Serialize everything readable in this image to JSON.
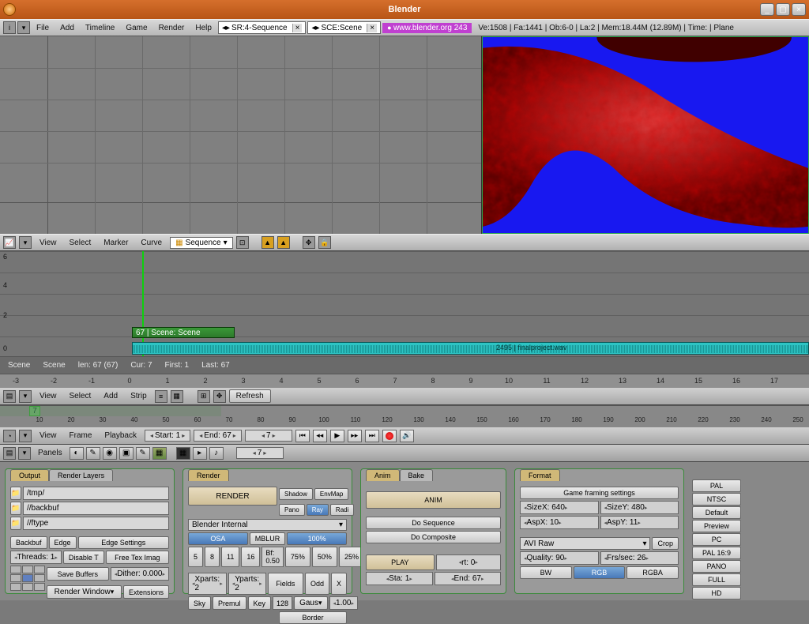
{
  "window": {
    "title": "Blender"
  },
  "topmenu": {
    "file": "File",
    "add": "Add",
    "timeline": "Timeline",
    "game": "Game",
    "render": "Render",
    "help": "Help",
    "screen": "SR:4-Sequence",
    "scene": "SCE:Scene",
    "link": "www.blender.org 243",
    "stats": "Ve:1508 | Fa:1441 | Ob:6-0 | La:2 | Mem:18.44M (12.89M) | Time: | Plane"
  },
  "ipo": {
    "view": "View",
    "select": "Select",
    "marker": "Marker",
    "curve": "Curve",
    "type": "Sequence"
  },
  "seq": {
    "scene_strip": "67 | Scene: Scene",
    "audio_strip": "2495 | finalproject.wav",
    "info_scene1": "Scene",
    "info_scene2": "Scene",
    "info_len": "len: 67 (67)",
    "info_cur": "Cur: 7",
    "info_first": "First: 1",
    "info_last": "Last: 67",
    "ticks": [
      "-3",
      "-2",
      "-1",
      "0",
      "1",
      "2",
      "3",
      "4",
      "5",
      "6",
      "7",
      "8",
      "9",
      "10",
      "11",
      "12",
      "13",
      "14",
      "15",
      "16",
      "17"
    ],
    "axis": [
      "0",
      "2",
      "4",
      "6"
    ],
    "header": {
      "view": "View",
      "select": "Select",
      "add": "Add",
      "strip": "Strip",
      "refresh": "Refresh"
    }
  },
  "timeline": {
    "current": "7",
    "ticks": [
      "10",
      "20",
      "30",
      "40",
      "50",
      "60",
      "70",
      "80",
      "90",
      "100",
      "110",
      "120",
      "130",
      "140",
      "150",
      "160",
      "170",
      "180",
      "190",
      "200",
      "210",
      "220",
      "230",
      "240",
      "250"
    ],
    "header": {
      "view": "View",
      "frame": "Frame",
      "playback": "Playback",
      "start": "Start: 1",
      "end": "End: 67",
      "cur": "7"
    }
  },
  "buttons": {
    "panels": "Panels",
    "cur": "7",
    "output": {
      "tab1": "Output",
      "tab2": "Render Layers",
      "tmp": "/tmp/",
      "backbuf": "//backbuf",
      "ftype": "//ftype",
      "backbuf_btn": "Backbuf",
      "edge": "Edge",
      "edge_settings": "Edge Settings",
      "threads": "Threads: 1",
      "disable": "Disable T",
      "freetex": "Free Tex Imag",
      "save": "Save Buffers",
      "dither": "Dither: 0.000",
      "renderwin": "Render Window",
      "ext": "Extensions"
    },
    "render": {
      "tab": "Render",
      "render": "RENDER",
      "engine": "Blender Internal",
      "shadow": "Shadow",
      "envmap": "EnvMap",
      "pano": "Pano",
      "ray": "Ray",
      "radi": "Radi",
      "osa": "OSA",
      "mblur": "MBLUR",
      "pct": "100%",
      "o5": "5",
      "o8": "8",
      "o11": "11",
      "o16": "16",
      "bf": "Bf: 0.50",
      "p75": "75%",
      "p50": "50%",
      "p25": "25%",
      "xparts": "Xparts: 2",
      "yparts": "Yparts: 2",
      "fields": "Fields",
      "odd": "Odd",
      "x": "X",
      "sky": "Sky",
      "premul": "Premul",
      "key": "Key",
      "n128": "128",
      "gaus": "Gaus",
      "n1": "1.00",
      "border": "Border"
    },
    "anim": {
      "tab1": "Anim",
      "tab2": "Bake",
      "anim": "ANIM",
      "doseq": "Do Sequence",
      "docomp": "Do Composite",
      "play": "PLAY",
      "rt": "rt: 0",
      "sta": "Sta: 1",
      "end": "End: 67"
    },
    "format": {
      "tab": "Format",
      "game": "Game framing settings",
      "sizex": "SizeX: 640",
      "sizey": "SizeY: 480",
      "aspx": "AspX: 10",
      "aspy": "AspY: 11",
      "codec": "AVI Raw",
      "crop": "Crop",
      "quality": "Quality: 90",
      "fps": "Frs/sec: 26",
      "bw": "BW",
      "rgb": "RGB",
      "rgba": "RGBA",
      "presets": [
        "PAL",
        "NTSC",
        "Default",
        "Preview",
        "PC",
        "PAL 16:9",
        "PANO",
        "FULL",
        "HD"
      ]
    }
  }
}
